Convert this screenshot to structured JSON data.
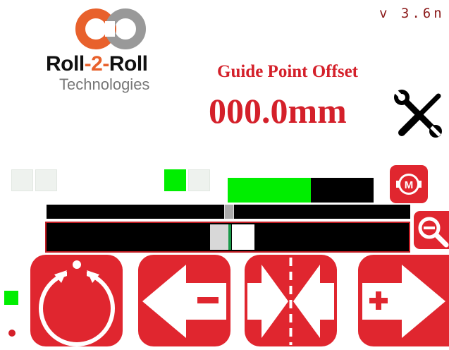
{
  "header": {
    "version": "v 3.6n",
    "brand_part1": "Roll",
    "brand_part2": "-2-",
    "brand_part3": "Roll",
    "brand_sub": "Technologies"
  },
  "guide_point": {
    "title": "Guide Point Offset",
    "value": "000.0mm"
  },
  "indicators": {
    "row_top": [
      "off",
      "off",
      "on",
      "off"
    ],
    "left_status": "on",
    "left_dot": "red"
  },
  "level_bar": {
    "fill_fraction": 0.57,
    "fill_color": "#00ee00"
  },
  "colors": {
    "accent_red": "#e0262f",
    "title_red": "#d4202a",
    "logo_orange": "#e8612c",
    "logo_gray": "#999999",
    "indicator_green": "#00ee00"
  },
  "icons": {
    "settings": "tools-icon",
    "motor": "motor-icon",
    "zoom": "zoom-out-icon",
    "auto": "auto-circle-icon",
    "left": "left-minus-arrow-icon",
    "center": "center-icon",
    "right": "right-plus-arrow-icon"
  }
}
